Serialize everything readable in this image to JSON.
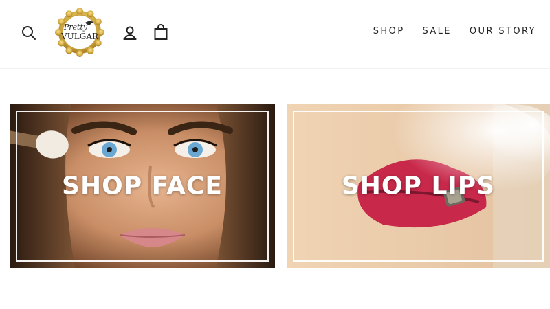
{
  "header": {
    "logo": {
      "line1": "Pretty",
      "line2": "VULGAR"
    },
    "icons": {
      "search": "search-icon",
      "account": "user-icon",
      "cart": "bag-icon"
    },
    "nav": [
      {
        "label": "SHOP"
      },
      {
        "label": "SALE"
      },
      {
        "label": "OUR STORY"
      }
    ]
  },
  "promos": [
    {
      "title": "SHOP FACE"
    },
    {
      "title": "SHOP LIPS"
    }
  ],
  "colors": {
    "logo_gold": "#d8b24a",
    "lip_red": "#c8284a",
    "text": "#222222"
  }
}
